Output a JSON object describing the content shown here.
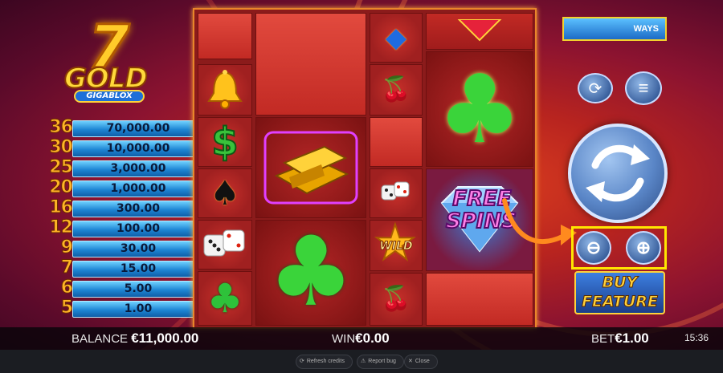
{
  "logo": {
    "seven": "7",
    "gold": "GOLD",
    "sub": "GIGABLOX"
  },
  "paytable": [
    {
      "count": "36",
      "value": "70,000.00"
    },
    {
      "count": "30",
      "value": "10,000.00"
    },
    {
      "count": "25",
      "value": "3,000.00"
    },
    {
      "count": "20",
      "value": "1,000.00"
    },
    {
      "count": "16",
      "value": "300.00"
    },
    {
      "count": "12",
      "value": "100.00"
    },
    {
      "count": "9",
      "value": "30.00"
    },
    {
      "count": "7",
      "value": "15.00"
    },
    {
      "count": "6",
      "value": "5.00"
    },
    {
      "count": "5",
      "value": "1.00"
    }
  ],
  "reels": {
    "free_spins_line1": "FREE",
    "free_spins_line2": "SPINS",
    "wild": "WILD"
  },
  "controls": {
    "ways": "WAYS",
    "buy_line1": "BUY",
    "buy_line2": "FEATURE"
  },
  "status": {
    "balance_label": "BALANCE",
    "balance_value": "€11,000.00",
    "win_label": "WIN",
    "win_value": "€0.00",
    "bet_label": "BET",
    "bet_value": "€1.00",
    "time": "15:36"
  },
  "footer": {
    "refresh": "Refresh credits",
    "report": "Report bug",
    "close": "Close"
  },
  "colors": {
    "accent": "#ffe600",
    "reel_frame": "#e9862a",
    "paytable_blue": "#1e86d4"
  }
}
